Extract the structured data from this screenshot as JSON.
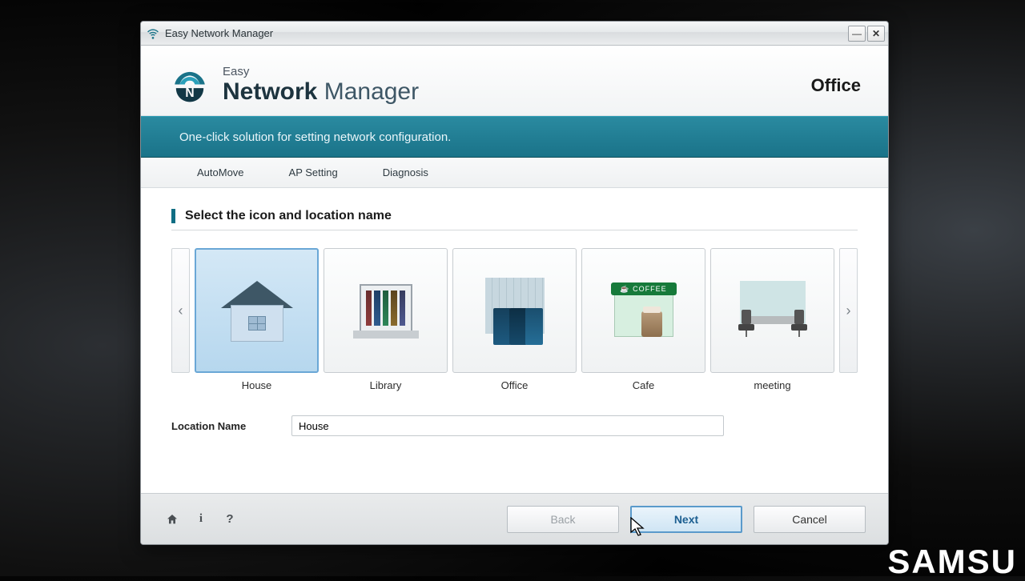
{
  "window": {
    "title": "Easy Network Manager"
  },
  "header": {
    "easy": "Easy",
    "network": "Network",
    "manager": "Manager",
    "current_location": "Office"
  },
  "tagline": "One-click solution for setting network configuration.",
  "tabs": {
    "automove": "AutoMove",
    "ap_setting": "AP Setting",
    "diagnosis": "Diagnosis"
  },
  "section_title": "Select the icon and location name",
  "cards": [
    {
      "label": "House",
      "selected": true
    },
    {
      "label": "Library",
      "selected": false
    },
    {
      "label": "Office",
      "selected": false
    },
    {
      "label": "Cafe",
      "selected": false
    },
    {
      "label": "meeting",
      "selected": false
    }
  ],
  "cafe_sign": "☕ COFFEE",
  "form": {
    "location_name_label": "Location Name",
    "location_name_value": "House"
  },
  "footer": {
    "back": "Back",
    "next": "Next",
    "cancel": "Cancel"
  },
  "brand_corner": "SAMSU"
}
